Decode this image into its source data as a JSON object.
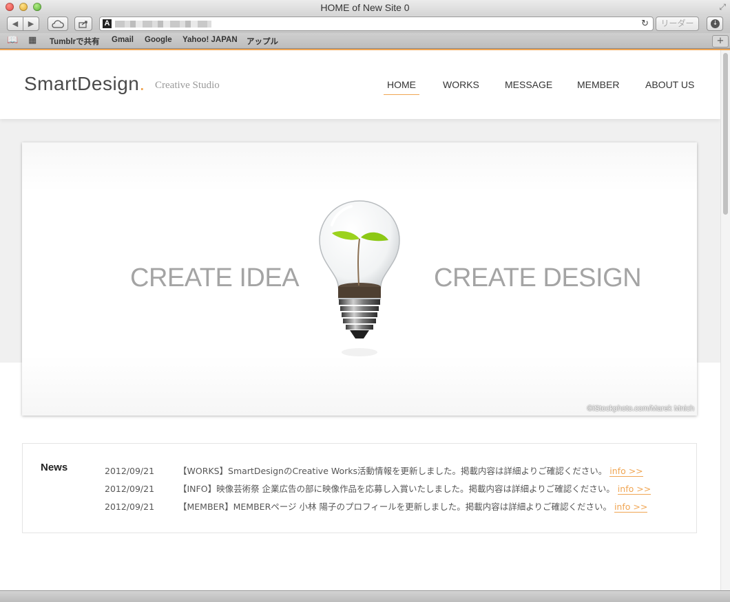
{
  "window": {
    "title": "HOME of New Site 0"
  },
  "toolbar": {
    "reader_label": "リーダー"
  },
  "bookmarks": [
    "Tumblrで共有",
    "Gmail",
    "Google",
    "Yahoo! JAPAN",
    "アップル"
  ],
  "site": {
    "logo": "SmartDesign",
    "logo_dot": ".",
    "tagline": "Creative Studio",
    "nav": [
      "HOME",
      "WORKS",
      "MESSAGE",
      "MEMBER",
      "ABOUT US"
    ],
    "active_nav": "HOME"
  },
  "hero": {
    "left_text": "CREATE IDEA",
    "right_text": "CREATE DESIGN",
    "credit": "©iStockphoto.com/Marek Mnich"
  },
  "news": {
    "title": "News",
    "items": [
      {
        "date": "2012/09/21",
        "text": "【WORKS】SmartDesignのCreative Works活動情報を更新しました。掲載内容は詳細よりご確認ください。",
        "link": "info >>"
      },
      {
        "date": "2012/09/21",
        "text": "【INFO】映像芸術祭 企業広告の部に映像作品を応募し入賞いたしました。掲載内容は詳細よりご確認ください。",
        "link": "info >>"
      },
      {
        "date": "2012/09/21",
        "text": "【MEMBER】MEMBERページ 小林 陽子のプロフィールを更新しました。掲載内容は詳細よりご確認ください。",
        "link": "info >>"
      }
    ]
  },
  "colors": {
    "accent": "#f0a552",
    "hero_text": "#a4a4a4",
    "band": "#f0f0f0"
  }
}
